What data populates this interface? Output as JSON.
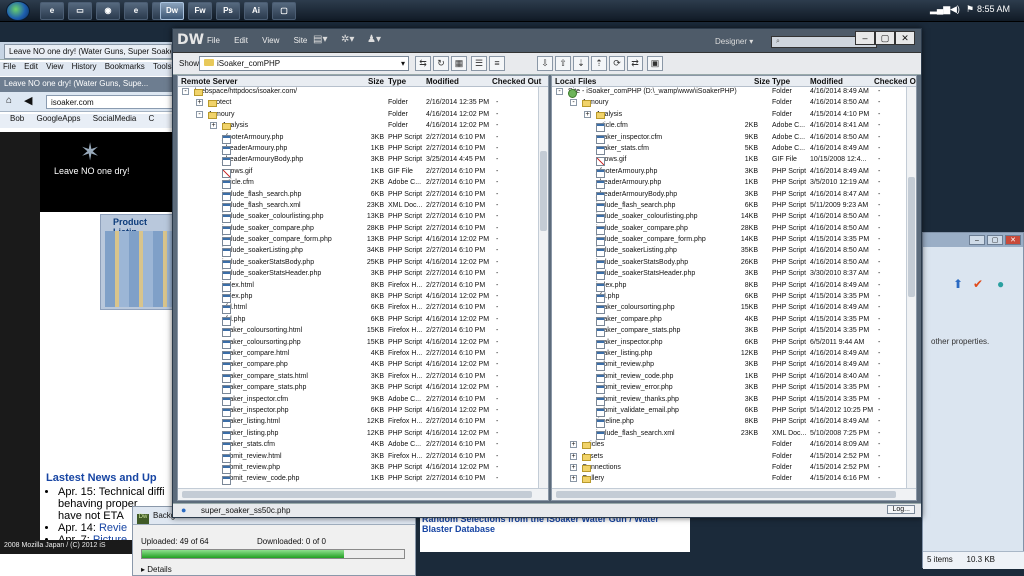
{
  "taskbar": {
    "clock": "8:55 AM",
    "buttons": [
      "ie",
      "folder",
      "firefox",
      "ie2",
      "chrome",
      "Dw",
      "Fw",
      "Ps",
      "Ai",
      "window"
    ],
    "tray_icons": [
      "network-icon",
      "volume-icon",
      "flag-icon",
      "power-icon"
    ]
  },
  "firefox": {
    "tab": "Leave NO one dry! (Water Guns, Super Soake",
    "menu": [
      "File",
      "Edit",
      "View",
      "History",
      "Bookmarks",
      "Tools"
    ],
    "active_tab": "Leave NO one dry! (Water Guns, Supe...",
    "url": "isoaker.com",
    "bookmarks": [
      "Bob",
      "GoogleApps",
      "SocialMedia",
      "C"
    ],
    "tagline": "Leave NO one dry!",
    "product_title": "Product Listin",
    "news_title": "Lastest News and Up",
    "news": [
      {
        "bullet": "Apr. 15: Technical diffi",
        "cont": "behaving proper",
        "cont2": "have not ETA"
      },
      {
        "bullet": "Apr. 14: ",
        "link": "Revie"
      },
      {
        "bullet": "Apr. 7: ",
        "link": "Picture"
      }
    ],
    "status": "2008 Mozilla Japan / (C) 2012 iS"
  },
  "bg_explorer": {
    "text": "other properties.",
    "items": "5 items",
    "size": "10.3 KB"
  },
  "bg_strip": {
    "text": "Random Selections from the iSoaker Water Gun / Water Blaster Database"
  },
  "upload": {
    "title": "Backgr",
    "uploaded": "Uploaded: 49 of 64",
    "downloaded": "Downloaded: 0 of 0",
    "progress": 0.77,
    "details": "Details"
  },
  "dw": {
    "logo": "DW",
    "menu": [
      "File",
      "Edit",
      "View",
      "Site"
    ],
    "workspace": "Designer",
    "search_placeholder": "",
    "show_label": "Show:",
    "site": "iSoaker_comPHP",
    "status_file": "super_soaker_ss50c.php",
    "log_button": "Log...",
    "remote": {
      "headers": [
        "Remote Server",
        "Size",
        "Type",
        "Modified",
        "Checked Out"
      ],
      "rows": [
        {
          "name": "/webspace/httpdocs/isoaker.com/",
          "size": "",
          "type": "",
          "mod": "",
          "co": "",
          "icon": "folder",
          "indent": 0,
          "exp": "-"
        },
        {
          "name": ".protect",
          "size": "",
          "type": "Folder",
          "mod": "2/16/2014 12:35 PM",
          "co": "-",
          "icon": "folder",
          "indent": 1,
          "exp": "+"
        },
        {
          "name": "Armoury",
          "size": "",
          "type": "Folder",
          "mod": "4/16/2014 12:02 PM",
          "co": "-",
          "icon": "folder",
          "indent": 1,
          "exp": "-"
        },
        {
          "name": "Analysis",
          "size": "",
          "type": "Folder",
          "mod": "4/16/2014 12:02 PM",
          "co": "-",
          "icon": "folder",
          "indent": 2,
          "exp": "+"
        },
        {
          "name": "_footerArmoury.php",
          "size": "3KB",
          "type": "PHP Script",
          "mod": "2/27/2014 6:10 PM",
          "co": "-",
          "icon": "php",
          "indent": 2
        },
        {
          "name": "_headerArmoury.php",
          "size": "1KB",
          "type": "PHP Script",
          "mod": "2/27/2014 6:10 PM",
          "co": "-",
          "icon": "php",
          "indent": 2
        },
        {
          "name": "_headerArmouryBody.php",
          "size": "3KB",
          "type": "PHP Script",
          "mod": "3/25/2014 4:45 PM",
          "co": "-",
          "icon": "php",
          "indent": 2
        },
        {
          "name": "arrows.gif",
          "size": "1KB",
          "type": "GIF File",
          "mod": "2/27/2014 6:10 PM",
          "co": "-",
          "icon": "gif",
          "indent": 2
        },
        {
          "name": "article.cfm",
          "size": "2KB",
          "type": "Adobe C...",
          "mod": "2/27/2014 6:10 PM",
          "co": "-",
          "icon": "php",
          "indent": 2
        },
        {
          "name": "include_flash_search.php",
          "size": "6KB",
          "type": "PHP Script",
          "mod": "2/27/2014 6:10 PM",
          "co": "-",
          "icon": "php",
          "indent": 2
        },
        {
          "name": "include_flash_search.xml",
          "size": "23KB",
          "type": "XML Doc...",
          "mod": "2/27/2014 6:10 PM",
          "co": "-",
          "icon": "php",
          "indent": 2
        },
        {
          "name": "include_soaker_colourlisting.php",
          "size": "13KB",
          "type": "PHP Script",
          "mod": "2/27/2014 6:10 PM",
          "co": "-",
          "icon": "php",
          "indent": 2
        },
        {
          "name": "include_soaker_compare.php",
          "size": "28KB",
          "type": "PHP Script",
          "mod": "2/27/2014 6:10 PM",
          "co": "-",
          "icon": "php",
          "indent": 2
        },
        {
          "name": "include_soaker_compare_form.php",
          "size": "13KB",
          "type": "PHP Script",
          "mod": "4/16/2014 12:02 PM",
          "co": "-",
          "icon": "php",
          "indent": 2
        },
        {
          "name": "include_soakerListing.php",
          "size": "34KB",
          "type": "PHP Script",
          "mod": "2/27/2014 6:10 PM",
          "co": "-",
          "icon": "php",
          "indent": 2
        },
        {
          "name": "include_soakerStatsBody.php",
          "size": "25KB",
          "type": "PHP Script",
          "mod": "4/16/2014 12:02 PM",
          "co": "-",
          "icon": "php",
          "indent": 2
        },
        {
          "name": "include_soakerStatsHeader.php",
          "size": "3KB",
          "type": "PHP Script",
          "mod": "2/27/2014 6:10 PM",
          "co": "-",
          "icon": "php",
          "indent": 2
        },
        {
          "name": "index.html",
          "size": "8KB",
          "type": "Firefox H...",
          "mod": "2/27/2014 6:10 PM",
          "co": "-",
          "icon": "php",
          "indent": 2
        },
        {
          "name": "index.php",
          "size": "8KB",
          "type": "PHP Script",
          "mod": "4/16/2014 12:02 PM",
          "co": "-",
          "icon": "php",
          "indent": 2
        },
        {
          "name": "qfd.html",
          "size": "6KB",
          "type": "Firefox H...",
          "mod": "2/27/2014 6:10 PM",
          "co": "-",
          "icon": "php",
          "indent": 2
        },
        {
          "name": "qfd.php",
          "size": "6KB",
          "type": "PHP Script",
          "mod": "4/16/2014 12:02 PM",
          "co": "-",
          "icon": "php",
          "indent": 2
        },
        {
          "name": "soaker_coloursorting.html",
          "size": "15KB",
          "type": "Firefox H...",
          "mod": "2/27/2014 6:10 PM",
          "co": "-",
          "icon": "php",
          "indent": 2
        },
        {
          "name": "soaker_coloursorting.php",
          "size": "15KB",
          "type": "PHP Script",
          "mod": "4/16/2014 12:02 PM",
          "co": "-",
          "icon": "php",
          "indent": 2
        },
        {
          "name": "soaker_compare.html",
          "size": "4KB",
          "type": "Firefox H...",
          "mod": "2/27/2014 6:10 PM",
          "co": "-",
          "icon": "php",
          "indent": 2
        },
        {
          "name": "soaker_compare.php",
          "size": "4KB",
          "type": "PHP Script",
          "mod": "4/16/2014 12:02 PM",
          "co": "-",
          "icon": "php",
          "indent": 2
        },
        {
          "name": "soaker_compare_stats.html",
          "size": "3KB",
          "type": "Firefox H...",
          "mod": "2/27/2014 6:10 PM",
          "co": "-",
          "icon": "php",
          "indent": 2
        },
        {
          "name": "soaker_compare_stats.php",
          "size": "3KB",
          "type": "PHP Script",
          "mod": "4/16/2014 12:02 PM",
          "co": "-",
          "icon": "php",
          "indent": 2
        },
        {
          "name": "soaker_inspector.cfm",
          "size": "9KB",
          "type": "Adobe C...",
          "mod": "2/27/2014 6:10 PM",
          "co": "-",
          "icon": "php",
          "indent": 2
        },
        {
          "name": "soaker_inspector.php",
          "size": "6KB",
          "type": "PHP Script",
          "mod": "4/16/2014 12:02 PM",
          "co": "-",
          "icon": "php",
          "indent": 2
        },
        {
          "name": "soaker_listing.html",
          "size": "12KB",
          "type": "Firefox H...",
          "mod": "2/27/2014 6:10 PM",
          "co": "-",
          "icon": "php",
          "indent": 2
        },
        {
          "name": "soaker_listing.php",
          "size": "12KB",
          "type": "PHP Script",
          "mod": "4/16/2014 12:02 PM",
          "co": "-",
          "icon": "php",
          "indent": 2
        },
        {
          "name": "soaker_stats.cfm",
          "size": "4KB",
          "type": "Adobe C...",
          "mod": "2/27/2014 6:10 PM",
          "co": "-",
          "icon": "php",
          "indent": 2
        },
        {
          "name": "submit_review.html",
          "size": "3KB",
          "type": "Firefox H...",
          "mod": "2/27/2014 6:10 PM",
          "co": "-",
          "icon": "php",
          "indent": 2
        },
        {
          "name": "submit_review.php",
          "size": "3KB",
          "type": "PHP Script",
          "mod": "4/16/2014 12:02 PM",
          "co": "-",
          "icon": "php",
          "indent": 2
        },
        {
          "name": "submit_review_code.php",
          "size": "1KB",
          "type": "PHP Script",
          "mod": "2/27/2014 6:10 PM",
          "co": "-",
          "icon": "php",
          "indent": 2
        }
      ]
    },
    "local": {
      "headers": [
        "Local Files",
        "Size",
        "Type",
        "Modified",
        "Checked O"
      ],
      "rows": [
        {
          "name": "Site - iSoaker_comPHP (D:\\_wamp\\www\\iSoakerPHP)",
          "size": "",
          "type": "Folder",
          "mod": "4/16/2014 8:49 AM",
          "co": "-",
          "icon": "root",
          "indent": 0,
          "exp": "-"
        },
        {
          "name": "Armoury",
          "size": "",
          "type": "Folder",
          "mod": "4/16/2014 8:50 AM",
          "co": "-",
          "icon": "folder",
          "indent": 1,
          "exp": "-"
        },
        {
          "name": "Analysis",
          "size": "",
          "type": "Folder",
          "mod": "4/15/2014 4:10 PM",
          "co": "-",
          "icon": "folder",
          "indent": 2,
          "exp": "+"
        },
        {
          "name": "article.cfm",
          "size": "2KB",
          "type": "Adobe C...",
          "mod": "4/16/2014 8:41 AM",
          "co": "-",
          "icon": "php",
          "indent": 2
        },
        {
          "name": "soaker_inspector.cfm",
          "size": "9KB",
          "type": "Adobe C...",
          "mod": "4/16/2014 8:50 AM",
          "co": "-",
          "icon": "php",
          "indent": 2
        },
        {
          "name": "soaker_stats.cfm",
          "size": "5KB",
          "type": "Adobe C...",
          "mod": "4/16/2014 8:49 AM",
          "co": "-",
          "icon": "php",
          "indent": 2
        },
        {
          "name": "arrows.gif",
          "size": "1KB",
          "type": "GIF File",
          "mod": "10/15/2008 12:4...",
          "co": "-",
          "icon": "gif",
          "indent": 2
        },
        {
          "name": "_footerArmoury.php",
          "size": "3KB",
          "type": "PHP Script",
          "mod": "4/16/2014 8:49 AM",
          "co": "-",
          "icon": "php",
          "indent": 2
        },
        {
          "name": "_headerArmoury.php",
          "size": "1KB",
          "type": "PHP Script",
          "mod": "3/5/2010 12:19 AM",
          "co": "-",
          "icon": "php",
          "indent": 2
        },
        {
          "name": "_headerArmouryBody.php",
          "size": "3KB",
          "type": "PHP Script",
          "mod": "4/16/2014 8:47 AM",
          "co": "-",
          "icon": "php",
          "indent": 2
        },
        {
          "name": "include_flash_search.php",
          "size": "6KB",
          "type": "PHP Script",
          "mod": "5/11/2009 9:23 AM",
          "co": "-",
          "icon": "php",
          "indent": 2
        },
        {
          "name": "include_soaker_colourlisting.php",
          "size": "14KB",
          "type": "PHP Script",
          "mod": "4/16/2014 8:50 AM",
          "co": "-",
          "icon": "php",
          "indent": 2
        },
        {
          "name": "include_soaker_compare.php",
          "size": "28KB",
          "type": "PHP Script",
          "mod": "4/16/2014 8:50 AM",
          "co": "-",
          "icon": "php",
          "indent": 2
        },
        {
          "name": "include_soaker_compare_form.php",
          "size": "14KB",
          "type": "PHP Script",
          "mod": "4/15/2014 3:35 PM",
          "co": "-",
          "icon": "php",
          "indent": 2
        },
        {
          "name": "include_soakerListing.php",
          "size": "35KB",
          "type": "PHP Script",
          "mod": "4/16/2014 8:50 AM",
          "co": "-",
          "icon": "php",
          "indent": 2
        },
        {
          "name": "include_soakerStatsBody.php",
          "size": "26KB",
          "type": "PHP Script",
          "mod": "4/16/2014 8:50 AM",
          "co": "-",
          "icon": "php",
          "indent": 2
        },
        {
          "name": "include_soakerStatsHeader.php",
          "size": "3KB",
          "type": "PHP Script",
          "mod": "3/30/2010 8:37 AM",
          "co": "-",
          "icon": "php",
          "indent": 2
        },
        {
          "name": "index.php",
          "size": "8KB",
          "type": "PHP Script",
          "mod": "4/16/2014 8:49 AM",
          "co": "-",
          "icon": "php",
          "indent": 2
        },
        {
          "name": "qfd.php",
          "size": "6KB",
          "type": "PHP Script",
          "mod": "4/15/2014 3:35 PM",
          "co": "-",
          "icon": "php",
          "indent": 2
        },
        {
          "name": "soaker_coloursorting.php",
          "size": "15KB",
          "type": "PHP Script",
          "mod": "4/16/2014 8:49 AM",
          "co": "-",
          "icon": "php",
          "indent": 2
        },
        {
          "name": "soaker_compare.php",
          "size": "4KB",
          "type": "PHP Script",
          "mod": "4/15/2014 3:35 PM",
          "co": "-",
          "icon": "php",
          "indent": 2
        },
        {
          "name": "soaker_compare_stats.php",
          "size": "3KB",
          "type": "PHP Script",
          "mod": "4/15/2014 3:35 PM",
          "co": "-",
          "icon": "php",
          "indent": 2
        },
        {
          "name": "soaker_inspector.php",
          "size": "6KB",
          "type": "PHP Script",
          "mod": "6/5/2011 9:44 AM",
          "co": "-",
          "icon": "php",
          "indent": 2
        },
        {
          "name": "soaker_listing.php",
          "size": "12KB",
          "type": "PHP Script",
          "mod": "4/16/2014 8:49 AM",
          "co": "-",
          "icon": "php",
          "indent": 2
        },
        {
          "name": "submit_review.php",
          "size": "3KB",
          "type": "PHP Script",
          "mod": "4/16/2014 8:49 AM",
          "co": "-",
          "icon": "php",
          "indent": 2
        },
        {
          "name": "submit_review_code.php",
          "size": "1KB",
          "type": "PHP Script",
          "mod": "4/16/2014 8:40 AM",
          "co": "-",
          "icon": "php",
          "indent": 2
        },
        {
          "name": "submit_review_error.php",
          "size": "3KB",
          "type": "PHP Script",
          "mod": "4/15/2014 3:35 PM",
          "co": "-",
          "icon": "php",
          "indent": 2
        },
        {
          "name": "submit_review_thanks.php",
          "size": "3KB",
          "type": "PHP Script",
          "mod": "4/15/2014 3:35 PM",
          "co": "-",
          "icon": "php",
          "indent": 2
        },
        {
          "name": "submit_validate_email.php",
          "size": "6KB",
          "type": "PHP Script",
          "mod": "5/14/2012 10:25 PM",
          "co": "-",
          "icon": "php",
          "indent": 2
        },
        {
          "name": "timeline.php",
          "size": "8KB",
          "type": "PHP Script",
          "mod": "4/16/2014 8:49 AM",
          "co": "-",
          "icon": "php",
          "indent": 2
        },
        {
          "name": "include_flash_search.xml",
          "size": "23KB",
          "type": "XML Doc...",
          "mod": "5/10/2008 7:25 PM",
          "co": "-",
          "icon": "php",
          "indent": 2
        },
        {
          "name": "articles",
          "size": "",
          "type": "Folder",
          "mod": "4/16/2014 8:09 AM",
          "co": "-",
          "icon": "folder",
          "indent": 1,
          "exp": "+"
        },
        {
          "name": "Assets",
          "size": "",
          "type": "Folder",
          "mod": "4/15/2014 2:52 PM",
          "co": "-",
          "icon": "folder",
          "indent": 1,
          "exp": "+"
        },
        {
          "name": "Connections",
          "size": "",
          "type": "Folder",
          "mod": "4/15/2014 2:52 PM",
          "co": "-",
          "icon": "folder",
          "indent": 1,
          "exp": "+"
        },
        {
          "name": "Gallery",
          "size": "",
          "type": "Folder",
          "mod": "4/15/2014 6:16 PM",
          "co": "-",
          "icon": "folder",
          "indent": 1,
          "exp": "+"
        }
      ]
    }
  }
}
